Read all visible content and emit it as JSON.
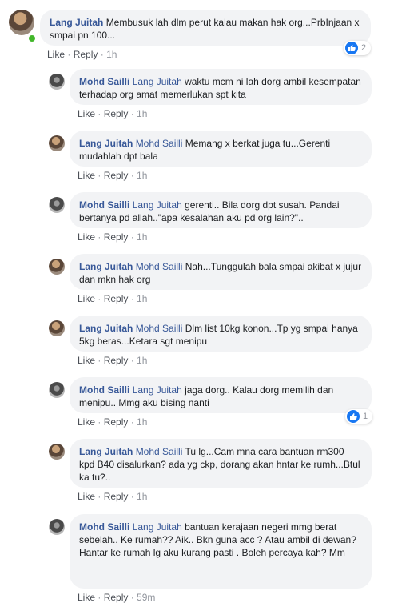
{
  "comments": [
    {
      "author": "Lang Juitah",
      "mention": "",
      "text": "Membusuk lah dlm perut kalau makan hak org...PrbInjaan x smpai pn 100...",
      "like": "Like",
      "reply": "Reply",
      "time": "1h",
      "reactions": "2"
    },
    {
      "author": "Mohd Sailli",
      "mention": "Lang Juitah",
      "text": "waktu mcm ni lah dorg ambil kesempatan terhadap org amat memerlukan spt kita",
      "like": "Like",
      "reply": "Reply",
      "time": "1h"
    },
    {
      "author": "Lang Juitah",
      "mention": "Mohd Sailli",
      "text": "Memang x berkat juga tu...Gerenti mudahlah dpt bala",
      "like": "Like",
      "reply": "Reply",
      "time": "1h"
    },
    {
      "author": "Mohd Sailli",
      "mention": "Lang Juitah",
      "text": "gerenti.. Bila dorg dpt susah. Pandai bertanya pd allah..\"apa kesalahan aku pd org lain?\"..",
      "like": "Like",
      "reply": "Reply",
      "time": "1h"
    },
    {
      "author": "Lang Juitah",
      "mention": "Mohd Sailli",
      "text": "Nah...Tunggulah bala smpai akibat x jujur dan mkn hak org",
      "like": "Like",
      "reply": "Reply",
      "time": "1h"
    },
    {
      "author": "Lang Juitah",
      "mention": "Mohd Sailli",
      "text": "Dlm list 10kg konon...Tp yg smpai hanya 5kg beras...Ketara sgt menipu",
      "like": "Like",
      "reply": "Reply",
      "time": "1h"
    },
    {
      "author": "Mohd Sailli",
      "mention": "Lang Juitah",
      "text": "jaga dorg.. Kalau dorg memilih dan menipu.. Mmg aku bising nanti",
      "like": "Like",
      "reply": "Reply",
      "time": "1h",
      "reactions": "1"
    },
    {
      "author": "Lang Juitah",
      "mention": "Mohd Sailli",
      "text": "Tu lg...Cam mna cara bantuan rm300 kpd B40 disalurkan? ada yg ckp, dorang akan hntar ke rumh...Btul ka tu?..",
      "like": "Like",
      "reply": "Reply",
      "time": "1h"
    },
    {
      "author": "Mohd Sailli",
      "mention": "Lang Juitah",
      "text": "bantuan kerajaan negeri mmg berat sebelah.. Ke rumah?? Aik.. Bkn guna acc ? Atau ambil di dewan? Hantar ke rumah lg aku kurang pasti . Boleh percaya kah? Mm",
      "like": "Like",
      "reply": "Reply",
      "time": "59m"
    }
  ],
  "icons": {
    "like_reaction": "thumbs-up-icon",
    "online": "online-status-dot"
  },
  "colors": {
    "name": "#385898",
    "bubble": "#f2f3f5",
    "like_blue": "#1877f2",
    "online": "#42b72a"
  }
}
